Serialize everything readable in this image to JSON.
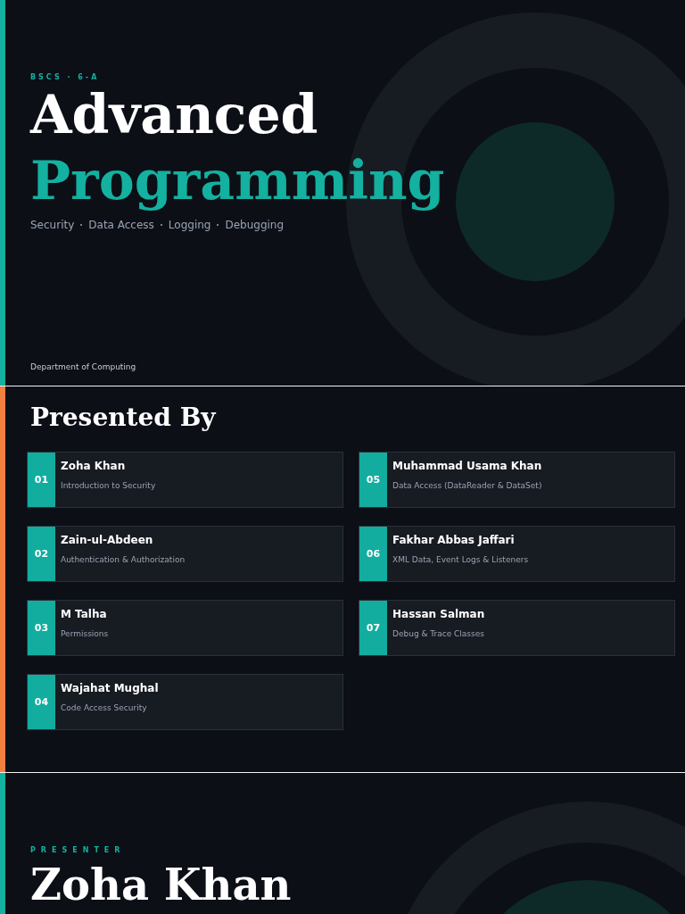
{
  "slides": [
    {
      "kind": "title",
      "color": "#14b0a0",
      "eyebrow": "BSCS · 6-A",
      "title_line_1": "Advanced",
      "title_line_2": "Programming",
      "topics": [
        "Security",
        "Data Access",
        "Logging",
        "Debugging"
      ],
      "footer": "Department of Computing"
    },
    {
      "kind": "presenters",
      "color": "#f08040",
      "heading": "Presented By",
      "presenters": [
        {
          "number": "01",
          "name": "Zoha Khan",
          "topic": "Introduction to Security"
        },
        {
          "number": "02",
          "name": "Zain-ul-Abdeen",
          "topic": "Authentication & Authorization"
        },
        {
          "number": "03",
          "name": "M Talha",
          "topic": "Permissions"
        },
        {
          "number": "04",
          "name": "Wajahat Mughal",
          "topic": "Code Access Security"
        },
        {
          "number": "05",
          "name": "Muhammad Usama Khan",
          "topic": "Data Access (DataReader & DataSet)"
        },
        {
          "number": "06",
          "name": "Fakhar Abbas Jaffari",
          "topic": "XML Data, Event Logs & Listeners"
        },
        {
          "number": "07",
          "name": "Hassan Salman",
          "topic": "Debug & Trace Classes"
        }
      ]
    },
    {
      "kind": "presenter",
      "color": "#14b0a0",
      "eyebrow": "PRESENTER",
      "name": "Zoha Khan"
    }
  ]
}
